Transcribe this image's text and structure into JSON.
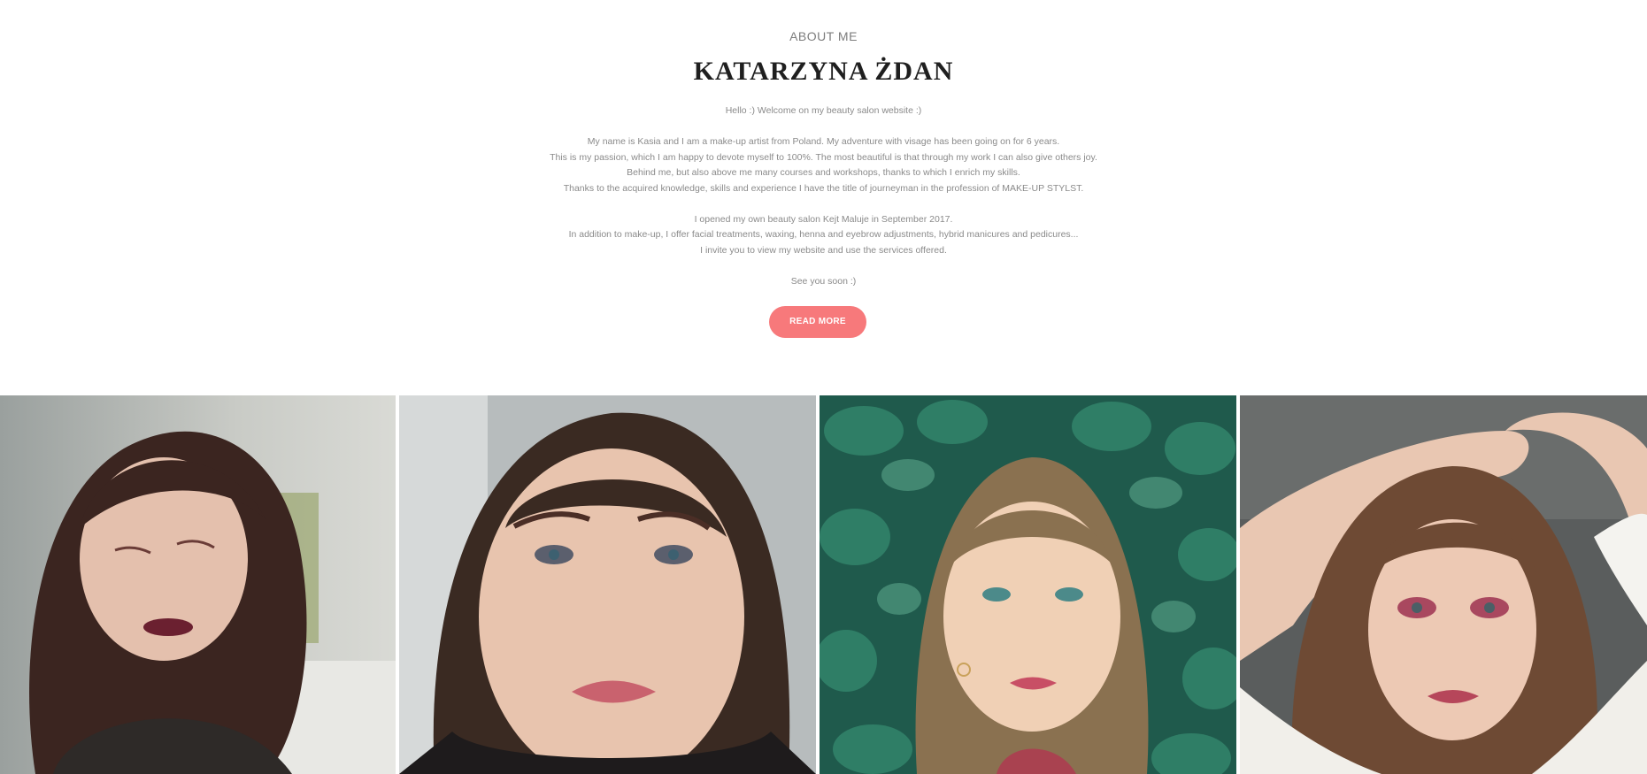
{
  "about": {
    "eyebrow": "ABOUT ME",
    "title": "KATARZYNA ŻDAN",
    "lines": [
      "Hello :) Welcome on my beauty salon website :)",
      "",
      "My name is Kasia and I am a make-up artist from Poland. My adventure with visage has been going on for 6 years.",
      "This is my passion, which I am happy to devote myself to 100%. The most beautiful is that through my work I can also give others joy.",
      "Behind me, but also above me many courses and workshops, thanks to which I enrich my skills.",
      "Thanks to the acquired knowledge, skills and experience I have the title of journeyman in the profession of MAKE-UP STYLST.",
      "",
      "I opened my own beauty salon Kejt Maluje in September 2017.",
      "In addition to make-up, I offer facial treatments, waxing, henna and eyebrow adjustments, hybrid manicures and pedicures...",
      "I invite you to view my website and use the services offered.",
      "",
      "See you soon :)"
    ],
    "button_label": "READ MORE"
  },
  "colors": {
    "accent": "#f7797b",
    "heading": "#1f1f1f",
    "body_text": "#8a8a8a"
  }
}
